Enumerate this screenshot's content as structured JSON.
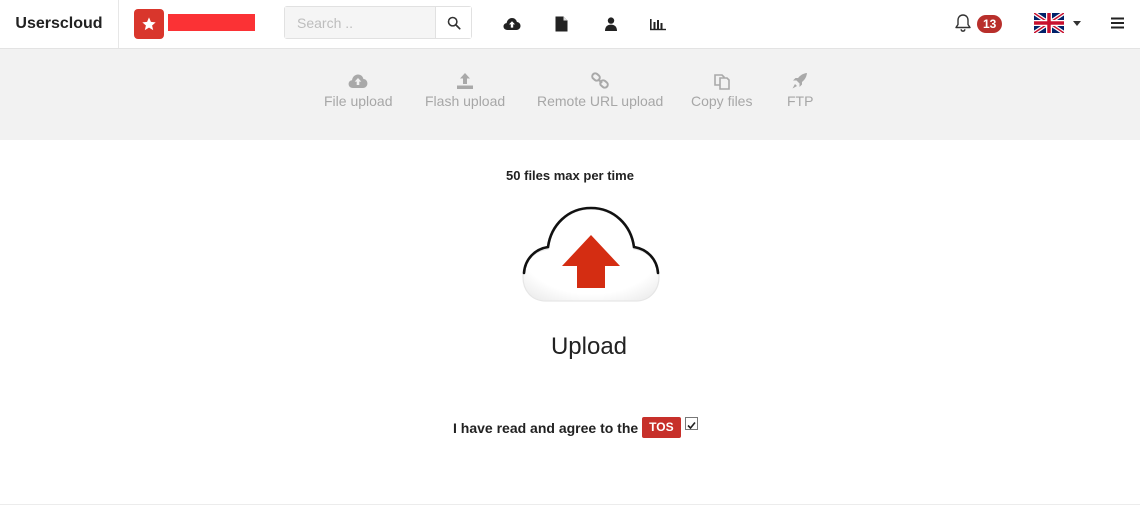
{
  "header": {
    "brand": "Userscloud",
    "search": {
      "placeholder": "Search ..",
      "value": ""
    },
    "nav_icons": [
      "cloud-upload-icon",
      "file-icon",
      "user-icon",
      "stats-icon"
    ],
    "notifications": {
      "count": "13"
    },
    "language": {
      "flag": "uk-flag-icon"
    },
    "colors": {
      "accent": "#d9362c",
      "badge": "#b82f2b"
    }
  },
  "upload_tabs": [
    {
      "label": "File upload",
      "icon": "cloud-upload-icon"
    },
    {
      "label": "Flash upload",
      "icon": "upload-icon"
    },
    {
      "label": "Remote URL upload",
      "icon": "link-icon"
    },
    {
      "label": "Copy files",
      "icon": "copy-icon"
    },
    {
      "label": "FTP",
      "icon": "rocket-icon"
    }
  ],
  "main": {
    "max_files": "50 files max per time",
    "upload_label": "Upload",
    "tos": {
      "text": "I have read and agree to the",
      "link": "TOS",
      "checked": true
    }
  }
}
